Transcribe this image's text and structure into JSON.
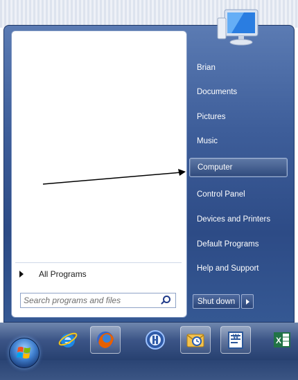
{
  "start_menu": {
    "all_programs": "All Programs",
    "search_placeholder": "Search programs and files",
    "right_items": [
      {
        "label": "Brian"
      },
      {
        "label": "Documents"
      },
      {
        "label": "Pictures"
      },
      {
        "label": "Music"
      },
      {
        "label": "Computer"
      },
      {
        "label": "Control Panel"
      },
      {
        "label": "Devices and Printers"
      },
      {
        "label": "Default Programs"
      },
      {
        "label": "Help and Support"
      }
    ],
    "selected_item": "Computer",
    "shutdown_label": "Shut down"
  },
  "taskbar": {
    "pinned": [
      {
        "icon": "internet-explorer-icon"
      },
      {
        "icon": "firefox-icon"
      },
      {
        "icon": "media-center-icon"
      },
      {
        "icon": "outlook-icon"
      },
      {
        "icon": "word-icon"
      },
      {
        "icon": "excel-icon"
      }
    ]
  },
  "colors": {
    "menu_blue": "#3e5e9a",
    "selection": "#5f79a6",
    "taskbar": "#243e6d"
  }
}
